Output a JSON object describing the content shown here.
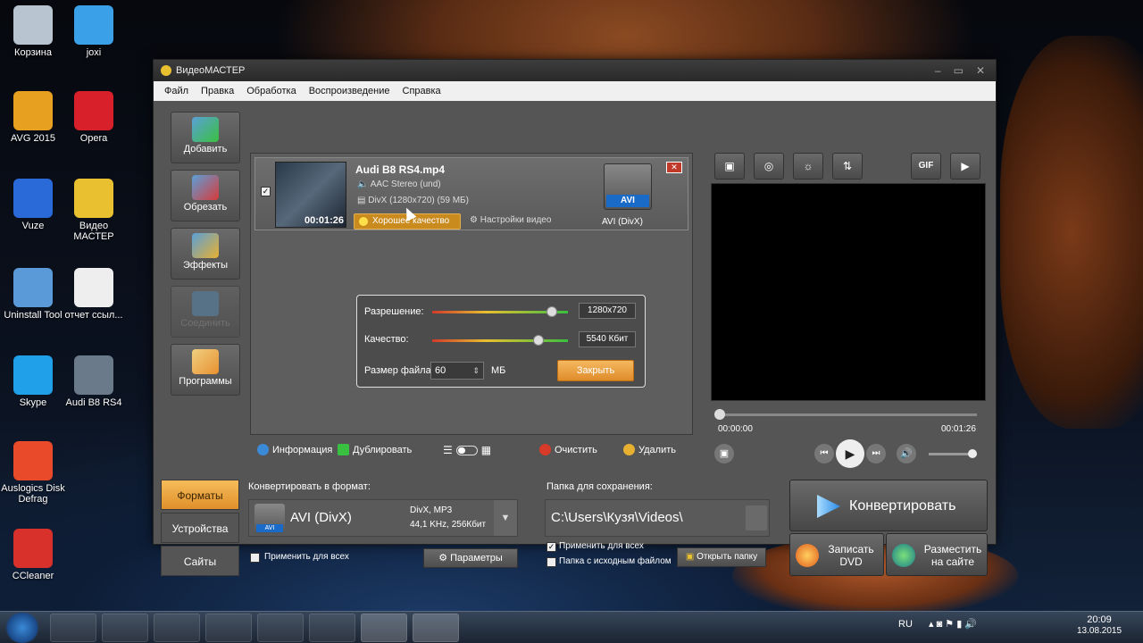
{
  "desktop": {
    "icons": [
      {
        "label": "Корзина",
        "icon": "recycle-bin-icon",
        "color": "#b8c4d0"
      },
      {
        "label": "joxi",
        "icon": "joxi-bird-icon",
        "color": "#3aa0e8"
      },
      {
        "label": "AVG 2015",
        "icon": "avg-icon",
        "color": "#e8a020"
      },
      {
        "label": "Opera",
        "icon": "opera-icon",
        "color": "#d8202a"
      },
      {
        "label": "Vuze",
        "icon": "vuze-frog-icon",
        "color": "#2a6ad8"
      },
      {
        "label": "Видео МАСТЕР",
        "icon": "videomaster-icon",
        "color": "#e8c030"
      },
      {
        "label": "Uninstall Tool",
        "icon": "uninstall-tool-icon",
        "color": "#5a9ad8"
      },
      {
        "label": "отчет ссыл...",
        "icon": "document-icon",
        "color": "#eeeeee"
      },
      {
        "label": "Skype",
        "icon": "skype-icon",
        "color": "#20a0e8"
      },
      {
        "label": "Audi B8 RS4",
        "icon": "video-file-icon",
        "color": "#6a7a8a"
      },
      {
        "label": "Auslogics Disk Defrag",
        "icon": "defrag-icon",
        "color": "#e84a2a"
      },
      {
        "label": "CCleaner",
        "icon": "ccleaner-icon",
        "color": "#d8302a"
      }
    ]
  },
  "window": {
    "title": "ВидеоМАСТЕР",
    "controls": [
      "–",
      "▭",
      "✕"
    ],
    "menu": [
      "Файл",
      "Правка",
      "Обработка",
      "Воспроизведение",
      "Справка"
    ]
  },
  "tools": [
    {
      "label": "Добавить",
      "color": "#3ac040",
      "enabled": true
    },
    {
      "label": "Обрезать",
      "color": "#d83a3a",
      "enabled": true
    },
    {
      "label": "Эффекты",
      "color": "#e8b030",
      "enabled": true
    },
    {
      "label": "Соединить",
      "color": "#5a8ab0",
      "enabled": false
    },
    {
      "label": "Программы",
      "color": "#e8c060",
      "enabled": true
    }
  ],
  "file": {
    "name": "Audi B8 RS4.mp4",
    "audio": "AAC Stereo (und)",
    "video": "DivX (1280x720) (59 МБ)",
    "duration": "00:01:26",
    "quality": "Хорошее качество",
    "video_settings": "Настройки видео",
    "format_badge": "AVI",
    "format_name": "AVI (DivX)",
    "checked": "✓",
    "remove": "✕"
  },
  "popup": {
    "resolution_label": "Разрешение:",
    "resolution_value": "1280x720",
    "resolution_level": 0.88,
    "quality_label": "Качество:",
    "quality_value": "5540 Кбит",
    "quality_level": 0.78,
    "filesize_label": "Размер файла:",
    "filesize_value": "60",
    "filesize_unit": "МБ",
    "close_label": "Закрыть"
  },
  "list_toolbar": {
    "info": "Информация",
    "duplicate": "Дублировать",
    "clear": "Очистить",
    "delete": "Удалить"
  },
  "preview": {
    "tools": [
      "▣",
      "◎",
      "☼",
      "⇅",
      "GIF",
      "▶"
    ],
    "time_start": "00:00:00",
    "time_end": "00:01:26",
    "volume_level": 0.9
  },
  "bottom": {
    "tabs": [
      "Форматы",
      "Устройства",
      "Сайты"
    ],
    "convert_to_label": "Конвертировать в формат:",
    "format_title": "AVI (DivX)",
    "format_codecs": "DivX, MP3",
    "format_audio": "44,1 KHz, 256Кбит",
    "format_badge": "AVI",
    "apply_all": "Применить для всех",
    "params": "Параметры",
    "save_folder_label": "Папка для сохранения:",
    "save_path": "C:\\Users\\Кузя\\Videos\\",
    "save_apply_all": "Применить для всех",
    "save_source_folder": "Папка с исходным файлом",
    "open_folder": "Открыть папку",
    "convert": "Конвертировать",
    "burn_dvd": "Записать DVD",
    "publish": "Разместить на сайте"
  },
  "taskbar": {
    "lang": "RU",
    "time": "20:09",
    "date": "13.08.2015"
  }
}
